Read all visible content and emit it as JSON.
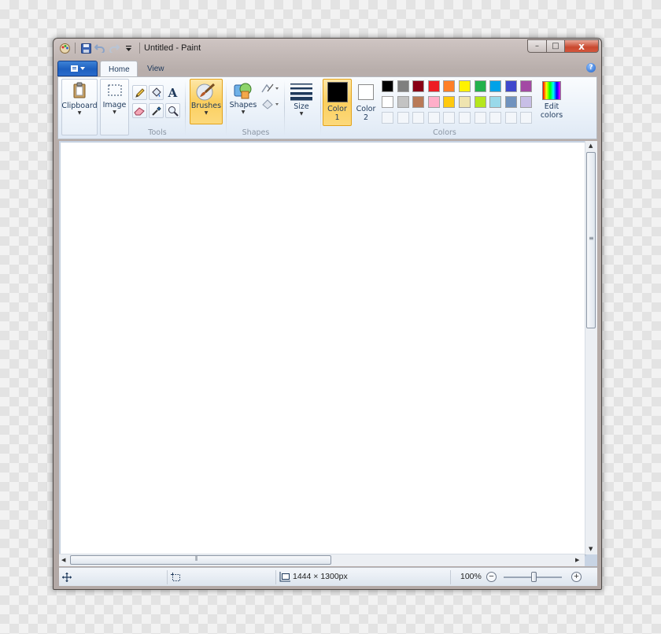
{
  "window": {
    "title": "Untitled - Paint"
  },
  "title_buttons": {
    "minimize": "–",
    "maximize": "□",
    "close": "x"
  },
  "tabs": [
    {
      "label": "Home"
    },
    {
      "label": "View"
    }
  ],
  "help_label": "?",
  "ribbon": {
    "clipboard": {
      "label": "Clipboard"
    },
    "image": {
      "label": "Image"
    },
    "tools_group": "Tools",
    "brushes": {
      "label": "Brushes"
    },
    "shapes": {
      "label": "Shapes"
    },
    "shapes_group": "Shapes",
    "size": {
      "label": "Size"
    },
    "color1": {
      "label": "Color",
      "number": "1"
    },
    "color2": {
      "label": "Color",
      "number": "2"
    },
    "colors_group": "Colors",
    "edit_colors": {
      "label": "Edit",
      "label2": "colors"
    }
  },
  "palette": {
    "row1": [
      "#000000",
      "#7f7f7f",
      "#880015",
      "#ed1c24",
      "#ff7f27",
      "#fff200",
      "#22b14c",
      "#00a2e8",
      "#3f48cc",
      "#a349a4"
    ],
    "row2": [
      "#ffffff",
      "#c3c3c3",
      "#b97a57",
      "#ffaec9",
      "#ffc90e",
      "#efe4b0",
      "#b5e61d",
      "#99d9ea",
      "#7092be",
      "#c8bfe7"
    ]
  },
  "colors": {
    "color1": "#000000",
    "color2": "#ffffff",
    "accent": "#fbcf5e"
  },
  "status": {
    "canvas_size": "1444 × 1300px",
    "zoom": "100%"
  }
}
